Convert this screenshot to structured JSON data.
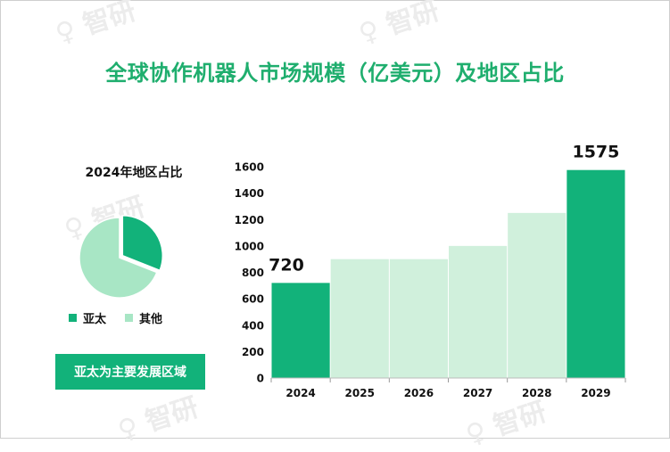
{
  "title": "全球协作机器人市场规模（亿美元）及地区占比",
  "pie": {
    "title": "2024年地区占比",
    "legend": [
      {
        "label": "亚太",
        "color": "#12b27a"
      },
      {
        "label": "其他",
        "color": "#a8e6c5"
      }
    ]
  },
  "callout": "亚太为主要发展区域",
  "colors": {
    "accent": "#12b27a",
    "light": "#d0f0dc",
    "pie_other": "#a8e6c5"
  },
  "chart_data": [
    {
      "type": "pie",
      "title": "2024年地区占比",
      "labels": [
        "亚太",
        "其他"
      ],
      "values": [
        0.31,
        0.69
      ]
    },
    {
      "type": "bar",
      "categories": [
        "2024",
        "2025",
        "2026",
        "2027",
        "2028",
        "2029"
      ],
      "values": [
        720,
        900,
        900,
        1000,
        1250,
        1575
      ],
      "highlighted": [
        "2024",
        "2029"
      ],
      "data_labels": {
        "2024": "720",
        "2029": "1575"
      },
      "ylim": [
        0,
        1600
      ],
      "yticks": [
        0,
        200,
        400,
        600,
        800,
        1000,
        1200,
        1400,
        1600
      ]
    }
  ]
}
